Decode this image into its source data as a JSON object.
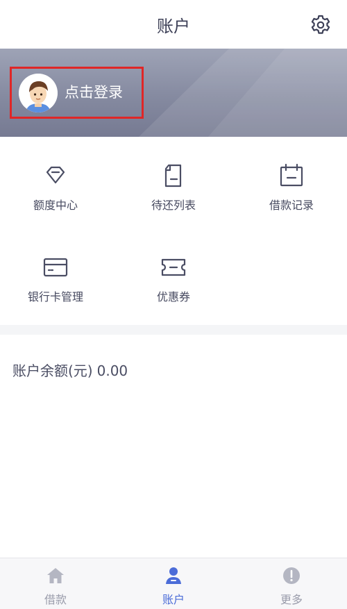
{
  "header": {
    "title": "账户",
    "settings_icon": "gear-icon"
  },
  "profile": {
    "login_label": "点击登录",
    "avatar_icon": "avatar"
  },
  "menu": [
    {
      "label": "额度中心",
      "icon": "diamond-icon"
    },
    {
      "label": "待还列表",
      "icon": "document-icon"
    },
    {
      "label": "借款记录",
      "icon": "calendar-icon"
    },
    {
      "label": "银行卡管理",
      "icon": "bank-card-icon"
    },
    {
      "label": "优惠券",
      "icon": "coupon-icon"
    }
  ],
  "balance": {
    "label": "账户余额(元)",
    "value": "0.00"
  },
  "tabbar": {
    "items": [
      {
        "label": "借款",
        "icon": "home-icon",
        "active": false
      },
      {
        "label": "账户",
        "icon": "user-icon",
        "active": true
      },
      {
        "label": "更多",
        "icon": "info-icon",
        "active": false
      }
    ]
  },
  "colors": {
    "accent": "#4b6cd8",
    "highlight_border": "#e02626",
    "banner": "#858aa0"
  }
}
